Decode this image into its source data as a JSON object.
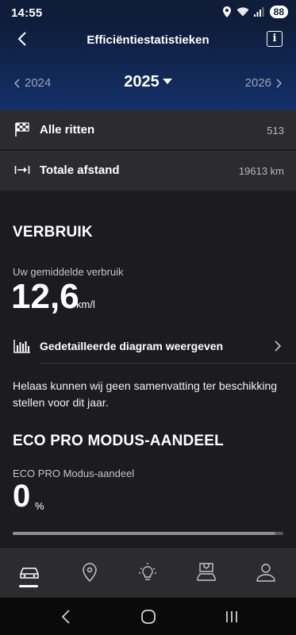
{
  "status_bar": {
    "time": "14:55",
    "battery": "88"
  },
  "header": {
    "title": "Efficiëntiestatistieken"
  },
  "year_selector": {
    "prev": "2024",
    "current": "2025",
    "next": "2026"
  },
  "summary": [
    {
      "label": "Alle ritten",
      "value": "513",
      "icon": "checkered-flag-icon"
    },
    {
      "label": "Totale afstand",
      "value": "19613 km",
      "icon": "distance-arrow-icon"
    }
  ],
  "consumption": {
    "heading": "VERBRUIK",
    "avg_label": "Uw gemiddelde verbruik",
    "avg_value": "12,6",
    "avg_unit": "km/l",
    "detail_link": "Gedetailleerde diagram weergeven",
    "message": "Helaas kunnen wij geen samenvatting ter beschikking stellen voor dit jaar."
  },
  "eco_pro": {
    "heading": "ECO PRO MODUS-AANDEEL",
    "label": "ECO PRO Modus-aandeel",
    "value": "0",
    "unit": "%",
    "progress_fraction": 0.97
  },
  "bottom_nav": [
    "car-icon",
    "location-pin-icon",
    "lightbulb-icon",
    "service-icon",
    "profile-icon"
  ],
  "colors": {
    "header_top": "#0f1d3b",
    "header_bottom": "#14306a",
    "background": "#1c1c1e",
    "row": "#2c2c2e"
  }
}
